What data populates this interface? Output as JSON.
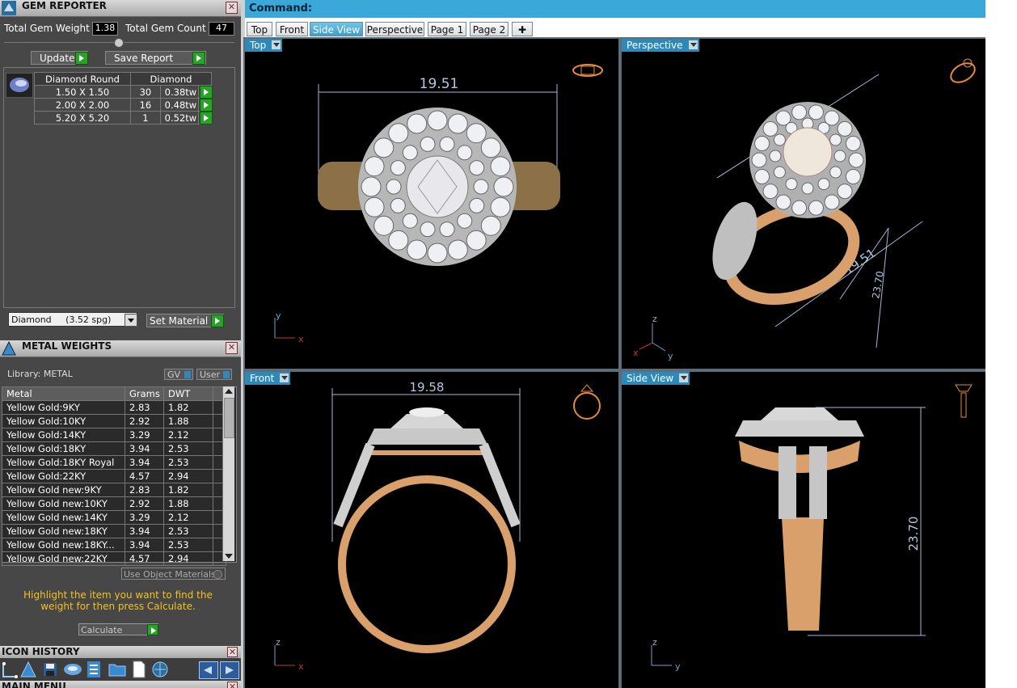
{
  "gem_reporter": {
    "title": "GEM REPORTER",
    "total_weight_label": "Total Gem Weight",
    "total_weight_value": "1.38",
    "total_count_label": "Total Gem Count",
    "total_count_value": "47",
    "update_label": "Update",
    "save_report_label": "Save Report",
    "table_headers": [
      "Diamond Round",
      "Diamond"
    ],
    "rows": [
      {
        "size": "1.50 X 1.50",
        "count": "30",
        "weight": "0.38tw"
      },
      {
        "size": "2.00 X 2.00",
        "count": "16",
        "weight": "0.48tw"
      },
      {
        "size": "5.20 X 5.20",
        "count": "1",
        "weight": "0.52tw"
      }
    ],
    "material_select": "Diamond     (3.52 spg)",
    "set_material_label": "Set Material"
  },
  "metal_weights": {
    "title": "METAL WEIGHTS",
    "library_label": "Library: METAL",
    "gv_label": "GV",
    "user_label": "User",
    "columns": [
      "Metal",
      "Grams",
      "DWT"
    ],
    "rows": [
      {
        "metal": "Yellow Gold:9KY",
        "grams": "2.83",
        "dwt": "1.82"
      },
      {
        "metal": "Yellow Gold:10KY",
        "grams": "2.92",
        "dwt": "1.88"
      },
      {
        "metal": "Yellow Gold:14KY",
        "grams": "3.29",
        "dwt": "2.12"
      },
      {
        "metal": "Yellow Gold:18KY",
        "grams": "3.94",
        "dwt": "2.53"
      },
      {
        "metal": "Yellow Gold:18KY Royal",
        "grams": "3.94",
        "dwt": "2.53"
      },
      {
        "metal": "Yellow Gold:22KY",
        "grams": "4.57",
        "dwt": "2.94"
      },
      {
        "metal": "Yellow Gold new:9KY",
        "grams": "2.83",
        "dwt": "1.82"
      },
      {
        "metal": "Yellow Gold new:10KY",
        "grams": "2.92",
        "dwt": "1.88"
      },
      {
        "metal": "Yellow Gold new:14KY",
        "grams": "3.29",
        "dwt": "2.12"
      },
      {
        "metal": "Yellow Gold new:18KY",
        "grams": "3.94",
        "dwt": "2.53"
      },
      {
        "metal": "Yellow Gold new:18KY...",
        "grams": "3.94",
        "dwt": "2.53"
      },
      {
        "metal": "Yellow Gold new:22KY",
        "grams": "4.57",
        "dwt": "2.94"
      }
    ],
    "use_object_materials_label": "Use Object Materials",
    "hint_text": "Highlight the item you want to find the weight for then press Calculate.",
    "calculate_label": "Calculate"
  },
  "icon_history": {
    "title": "ICON HISTORY",
    "icons": [
      "dimension-icon",
      "pyramid-icon",
      "save-icon",
      "gem-icon",
      "report-icon",
      "folder-icon",
      "document-icon",
      "globe-icon"
    ]
  },
  "main_menu": {
    "title": "MAIN MENU"
  },
  "command_bar": {
    "label": "Command:"
  },
  "tabs": [
    "Top",
    "Front",
    "Side View",
    "Perspective",
    "Page 1",
    "Page 2"
  ],
  "active_tab": "Side View",
  "viewports": {
    "top": {
      "label": "Top",
      "dimension": "19.51",
      "axis_a": "y",
      "axis_b": "x"
    },
    "perspective": {
      "label": "Perspective",
      "dimension_a": "19.51",
      "dimension_b": "23.70",
      "axis_a": "z",
      "axis_b": "x",
      "axis_c": "y"
    },
    "front": {
      "label": "Front",
      "dimension": "19.58",
      "axis_a": "z",
      "axis_b": "x"
    },
    "side": {
      "label": "Side View",
      "dimension": "23.70",
      "axis_a": "z",
      "axis_b": "y"
    }
  },
  "colors": {
    "command_bar": "#3aa8d8",
    "viewport_bg": "#000000",
    "gold": "#d9a06b",
    "dimension_line": "#a9b8d8",
    "hint_text": "#f3c21a",
    "green_button": "#28a328"
  }
}
